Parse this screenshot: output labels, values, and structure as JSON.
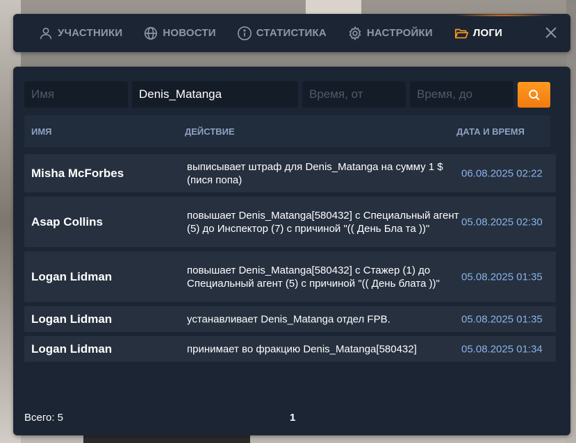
{
  "nav": {
    "items": [
      {
        "label": "УЧАСТНИКИ",
        "icon": "user-icon",
        "active": false
      },
      {
        "label": "НОВОСТИ",
        "icon": "globe-icon",
        "active": false
      },
      {
        "label": "СТАТИСТИКА",
        "icon": "info-icon",
        "active": false
      },
      {
        "label": "НАСТРОЙКИ",
        "icon": "gear-icon",
        "active": false
      },
      {
        "label": "ЛОГИ",
        "icon": "folder-open-icon",
        "active": true
      }
    ],
    "accent_color": "#ff9a1f"
  },
  "filters": {
    "name": {
      "value": "",
      "placeholder": "Имя"
    },
    "target": {
      "value": "Denis_Matanga",
      "placeholder": ""
    },
    "time_from": {
      "value": "",
      "placeholder": "Время, от"
    },
    "time_to": {
      "value": "",
      "placeholder": "Время, до"
    }
  },
  "table": {
    "headers": {
      "name": "ИМЯ",
      "action": "ДЕЙСТВИЕ",
      "datetime": "ДАТА И ВРЕМЯ"
    },
    "rows": [
      {
        "name": "Misha McForbes",
        "action": "выписывает штраф для Denis_Matanga на сумму 1 $ (пися попа)",
        "datetime": "06.08.2025 02:22"
      },
      {
        "name": "Asap Collins",
        "action": "повышает Denis_Matanga[580432] с Специальный агент (5) до Инспектор (7) с причиной \"(( День Бла та ))\"",
        "datetime": "05.08.2025 02:30"
      },
      {
        "name": "Logan Lidman",
        "action": "повышает Denis_Matanga[580432] с Стажер (1) до Специальный агент (5) с причиной \"(( День блата ))\"",
        "datetime": "05.08.2025 01:35"
      },
      {
        "name": "Logan Lidman",
        "action": "устанавливает Denis_Matanga отдел FPB.",
        "datetime": "05.08.2025 01:35"
      },
      {
        "name": "Logan Lidman",
        "action": "принимает во фракцию Denis_Matanga[580432]",
        "datetime": "05.08.2025 01:34"
      }
    ]
  },
  "footer": {
    "total": "Всего: 5",
    "page": "1"
  }
}
